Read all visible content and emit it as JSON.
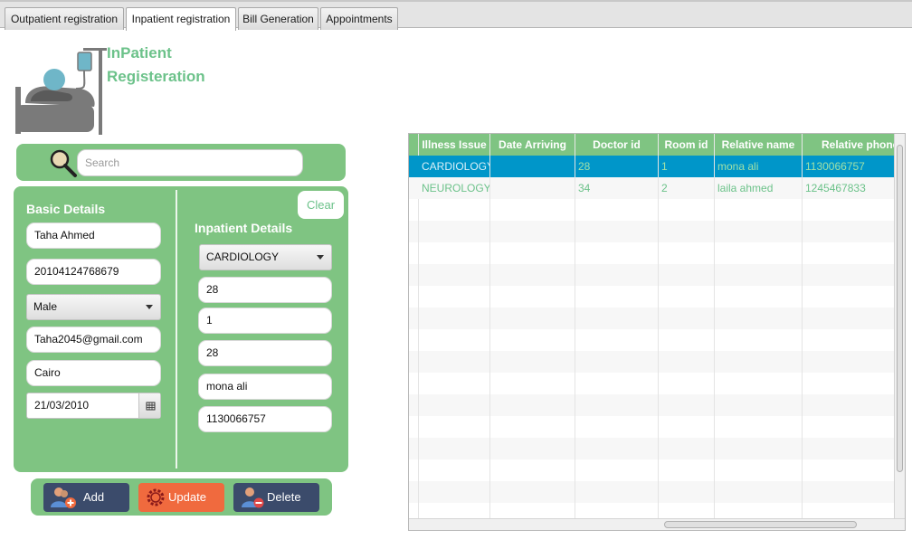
{
  "tabs": [
    {
      "label": "Outpatient registration"
    },
    {
      "label": "Inpatient registration"
    },
    {
      "label": "Bill Generation"
    },
    {
      "label": "Appointments"
    }
  ],
  "header": {
    "title_line1": "InPatient",
    "title_line2": "Registeration"
  },
  "search": {
    "placeholder": "Search"
  },
  "basic": {
    "title": "Basic Details",
    "name": "Taha Ahmed",
    "national_id": "20104124768679",
    "gender": "Male",
    "email": "Taha2045@gmail.com",
    "city": "Cairo",
    "birth_date": "21/03/2010"
  },
  "inpatient": {
    "title": "Inpatient Details",
    "illness": "CARDIOLOGY",
    "doctor_id": "28",
    "room_id": "1",
    "field4": "28",
    "relative_name": "mona ali",
    "relative_phone": "1130066757"
  },
  "buttons": {
    "clear": "Clear",
    "add": "Add",
    "update": "Update",
    "delete": "Delete"
  },
  "colors": {
    "accent_green": "#7fc482",
    "title_green": "#6cc28a",
    "selection": "#0096c9",
    "update_orange": "#f06a3e",
    "button_navy": "#3b4b6b"
  },
  "table": {
    "columns": [
      "Illness Issue",
      "Date Arriving",
      "Doctor id",
      "Room id",
      "Relative name",
      "Relative phone"
    ],
    "rows": [
      [
        "CARDIOLOGY",
        "",
        "28",
        "1",
        "mona ali",
        "1130066757"
      ],
      [
        "NEUROLOGY",
        "",
        "34",
        "2",
        "laila ahmed",
        "1245467833"
      ]
    ],
    "selected_row": 0
  }
}
